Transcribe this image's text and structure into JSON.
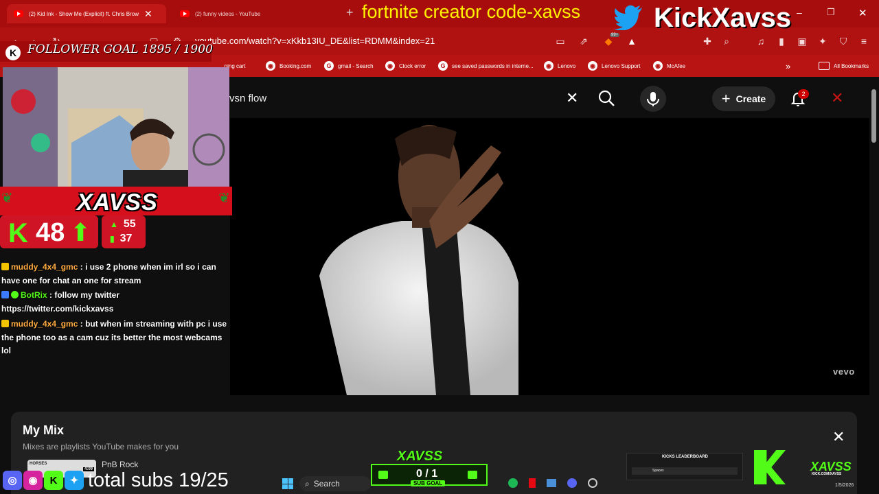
{
  "browser": {
    "tabs": [
      {
        "label": "(2) Kid Ink - Show Me (Explicit) ft. Chris Brow"
      },
      {
        "label": "(2) funny videos - YouTube"
      }
    ],
    "url": "youtube.com/watch?v=xKkb13IU_DE&list=RDMM&index=21",
    "bookmarks": [
      {
        "label": "...ping cart",
        "icon": "cart-icon"
      },
      {
        "label": "Booking.com",
        "icon": "globe-icon"
      },
      {
        "label": "gmail - Search",
        "icon": "google-icon"
      },
      {
        "label": "Clock error",
        "icon": "globe-icon"
      },
      {
        "label": "see saved passwords in interne...",
        "icon": "google-icon"
      },
      {
        "label": "Lenovo",
        "icon": "globe-icon"
      },
      {
        "label": "Lenovo Support",
        "icon": "globe-icon"
      },
      {
        "label": "McAfee",
        "icon": "globe-icon"
      }
    ],
    "all_bookmarks": "All Bookmarks",
    "notification_count": "99+"
  },
  "youtube": {
    "search_value": "vsn flow",
    "create_label": "Create",
    "notification_badge": "2",
    "watermark": "vevo",
    "mix": {
      "title": "My Mix",
      "subtitle": "Mixes are playlists YouTube makes for you",
      "first_item": "PnB Rock",
      "thumb_text": "HORSES",
      "thumb_duration": "4:09"
    }
  },
  "overlay": {
    "creator_code": "fortnite creator code-xavss",
    "kick_handle": "KickXavss",
    "follower_goal": "FOLLOWER GOAL 1895 / 1900",
    "streamer_name": "XAVSS",
    "kicks_count": "48",
    "stat_top": "55",
    "stat_bottom": "37",
    "chat": [
      {
        "user": "muddy_4x4_gmc",
        "message": "i use 2 phone when im irl so i can have one for chat an one for stream"
      },
      {
        "user": "BotRix",
        "message": "follow my twitter https://twitter.com/kickxavss"
      },
      {
        "user": "muddy_4x4_gmc",
        "message": "but when im streaming with pc i use the phone too as a cam cuz its better the most webcams lol"
      }
    ],
    "total_subs": "total subs 19/25",
    "sub_goal_name": "XAVSS",
    "sub_goal_count": "0 / 1",
    "sub_goal_label": "SUB GOAL",
    "leaderboard_title": "KICKS LEADERBOARD",
    "leaderboard_entry": "Spacex",
    "brand_name": "XAVSS",
    "brand_url": "KICK.COM/XAVSS"
  },
  "taskbar": {
    "search_label": "Search",
    "date": "1/5/2026"
  },
  "colors": {
    "browser_red": "#b01212",
    "kick_green": "#53fc18",
    "creator_code_yellow": "#fff200"
  }
}
